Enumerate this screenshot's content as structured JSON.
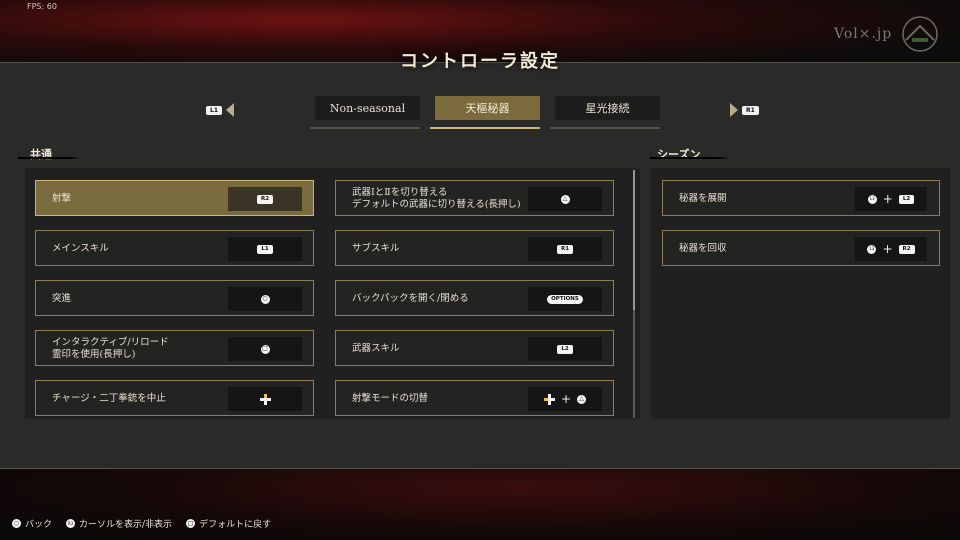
{
  "overlay": {
    "fps": "FPS: 60",
    "watermark": "Vol×.jp"
  },
  "title": "コントローラ設定",
  "tabs": {
    "left_button": "L1",
    "right_button": "R1",
    "items": [
      {
        "label": "Non-seasonal",
        "active": false
      },
      {
        "label": "天樞秘器",
        "active": true
      },
      {
        "label": "星光接続",
        "active": false
      }
    ]
  },
  "sections": {
    "common": "共通",
    "season": "シーズン"
  },
  "common_left": [
    {
      "label": "射撃",
      "buttons": [
        "R2"
      ],
      "selected": true
    },
    {
      "label": "メインスキル",
      "buttons": [
        "L1"
      ]
    },
    {
      "label": "突進",
      "buttons": [
        "circle"
      ]
    },
    {
      "label": "インタラクティブ/リロード\n霊印を使用(長押し)",
      "buttons": [
        "square"
      ]
    },
    {
      "label": "チャージ・二丁拳銃を中止",
      "buttons": [
        "dpad"
      ]
    }
  ],
  "common_right": [
    {
      "label": "武器ⅠとⅡを切り替える\nデフォルトの武器に切り替える(長押し)",
      "buttons": [
        "triangle"
      ]
    },
    {
      "label": "サブスキル",
      "buttons": [
        "R1"
      ]
    },
    {
      "label": "バックパックを開く/閉める",
      "buttons": [
        "OPTIONS"
      ]
    },
    {
      "label": "武器スキル",
      "buttons": [
        "L2"
      ]
    },
    {
      "label": "射撃モードの切替",
      "buttons": [
        "dpad",
        "+",
        "triangle"
      ]
    }
  ],
  "season_items": [
    {
      "label": "秘器を展開",
      "buttons": [
        "L3",
        "+",
        "L2"
      ]
    },
    {
      "label": "秘器を回収",
      "buttons": [
        "L3",
        "+",
        "R2"
      ]
    }
  ],
  "footer": [
    {
      "glyph": "○",
      "label": "バック"
    },
    {
      "glyph": "R3",
      "label": "カーソルを表示/非表示"
    },
    {
      "glyph": "□",
      "label": "デフォルトに戻す"
    }
  ]
}
